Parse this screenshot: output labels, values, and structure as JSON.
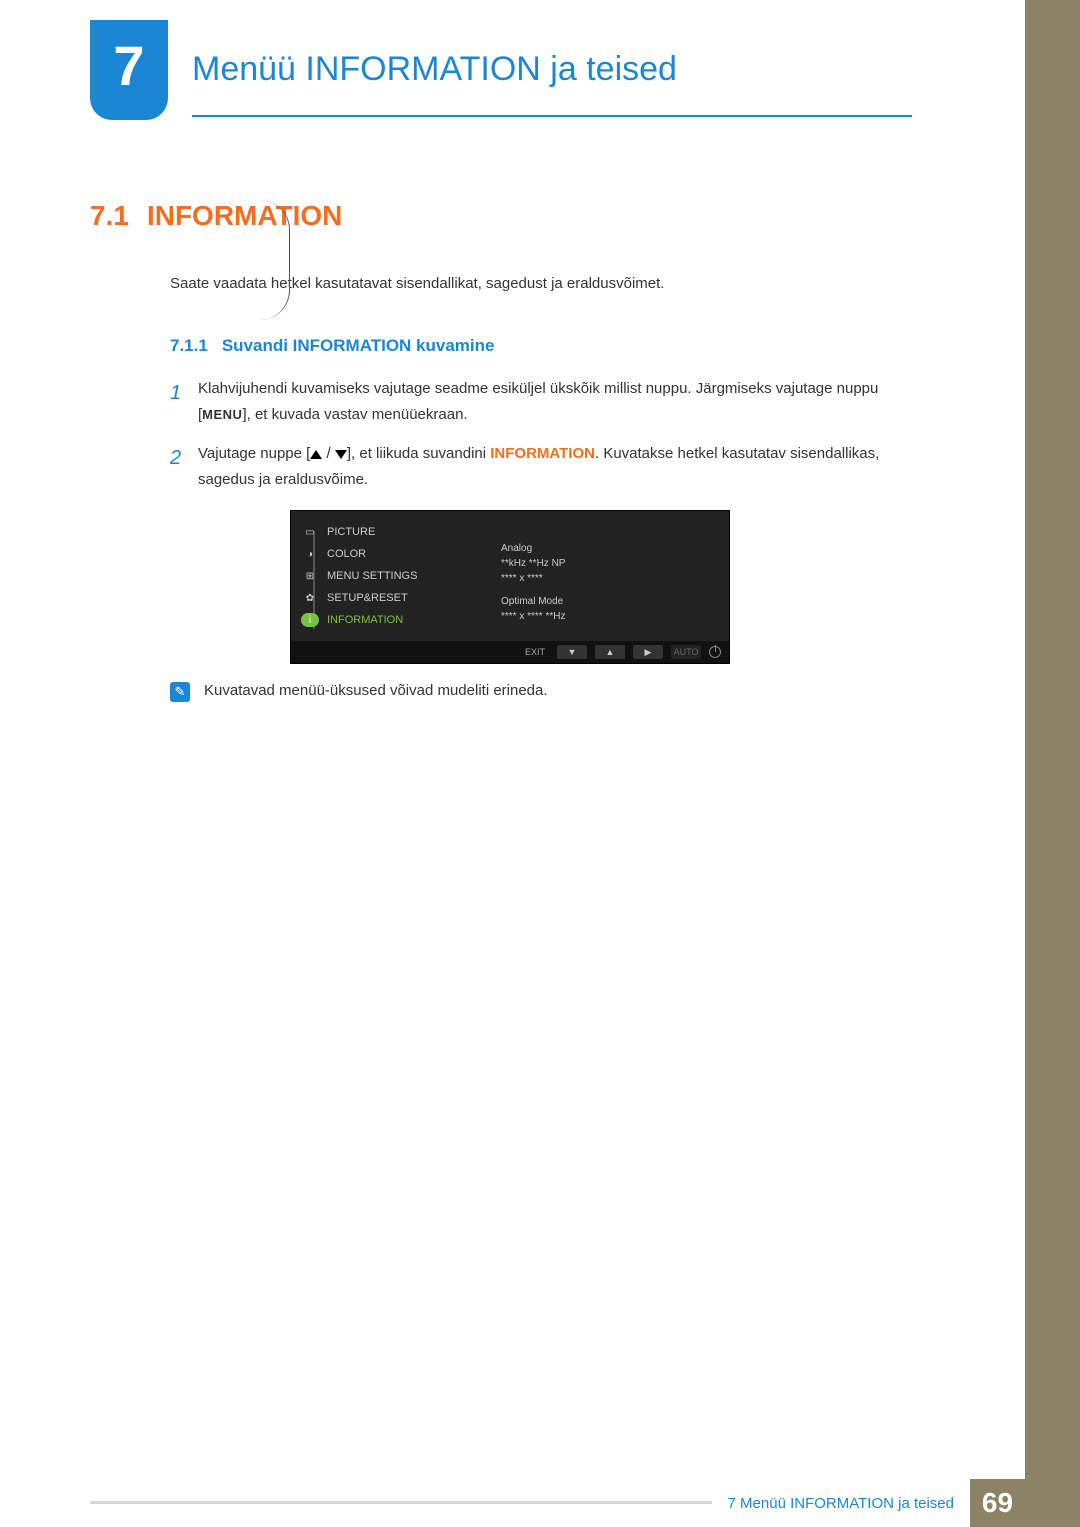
{
  "chapter": {
    "number": "7",
    "title": "Menüü INFORMATION ja teised"
  },
  "section": {
    "number": "7.1",
    "title": "INFORMATION"
  },
  "intro": "Saate vaadata hetkel kasutatavat sisendallikat, sagedust ja eraldusvõimet.",
  "subsection": {
    "number": "7.1.1",
    "title": "Suvandi INFORMATION kuvamine"
  },
  "steps": [
    {
      "n": "1",
      "pre": "Klahvijuhendi kuvamiseks vajutage seadme esiküljel ükskõik millist nuppu. Järgmiseks vajutage nuppu [",
      "key": "MENU",
      "post": "], et kuvada vastav menüüekraan."
    },
    {
      "n": "2",
      "pre": "Vajutage nuppe [",
      "mid": "], et liikuda suvandini ",
      "hl": "INFORMATION",
      "post": ". Kuvatakse hetkel kasutatav sisendallikas, sagedus ja eraldusvõime."
    }
  ],
  "osd": {
    "menu": [
      "PICTURE",
      "COLOR",
      "MENU SETTINGS",
      "SETUP&RESET",
      "INFORMATION"
    ],
    "info": {
      "l1": "Analog",
      "l2": "**kHz **Hz NP",
      "l3": "**** x ****",
      "l4": "Optimal Mode",
      "l5": "**** x **** **Hz"
    },
    "footer": {
      "exit": "EXIT",
      "auto": "AUTO"
    }
  },
  "note": "Kuvatavad menüü-üksused võivad mudeliti erineda.",
  "footer": {
    "text": "7 Menüü INFORMATION ja teised",
    "page": "69"
  }
}
